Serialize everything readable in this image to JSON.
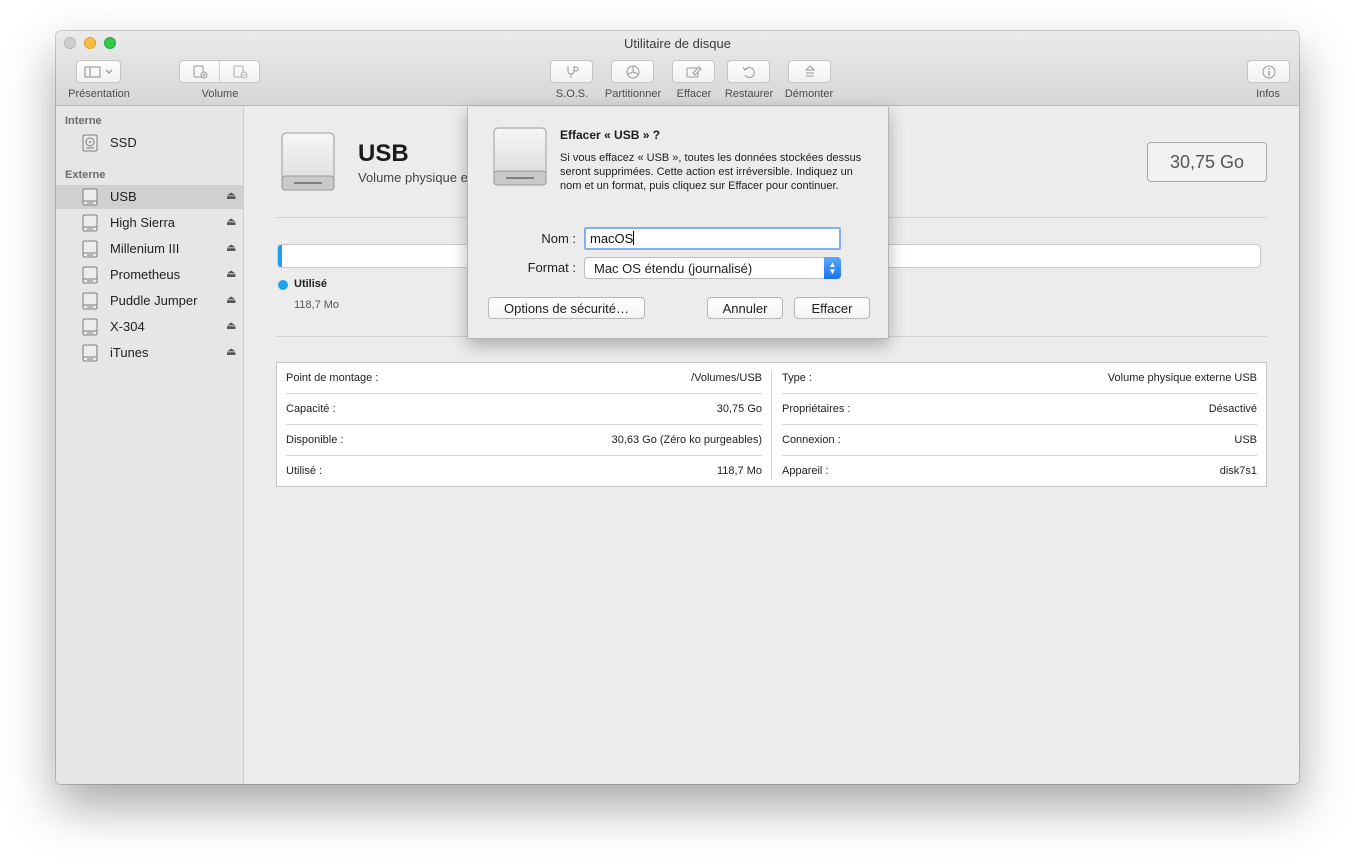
{
  "window": {
    "title": "Utilitaire de disque"
  },
  "toolbar": {
    "presentation_label": "Présentation",
    "volume_label": "Volume",
    "sos_label": "S.O.S.",
    "partition_label": "Partitionner",
    "erase_label": "Effacer",
    "restore_label": "Restaurer",
    "unmount_label": "Démonter",
    "info_label": "Infos"
  },
  "sidebar": {
    "internal_header": "Interne",
    "internal_items": [
      {
        "label": "SSD"
      }
    ],
    "external_header": "Externe",
    "external_items": [
      {
        "label": "USB",
        "eject": "⏏"
      },
      {
        "label": "High Sierra",
        "eject": "⏏"
      },
      {
        "label": "Millenium III",
        "eject": "⏏"
      },
      {
        "label": "Prometheus",
        "eject": "⏏"
      },
      {
        "label": "Puddle Jumper",
        "eject": "⏏"
      },
      {
        "label": "X-304",
        "eject": "⏏"
      },
      {
        "label": "iTunes",
        "eject": "⏏"
      }
    ]
  },
  "main": {
    "disk_name": "USB",
    "disk_subtitle": "Volume physique externe USB",
    "capacity": "30,75 Go",
    "usage": {
      "used_fraction": 0.004,
      "legend_name": "Utilisé",
      "legend_value": "118,7 Mo",
      "color": "#1ca2ea"
    },
    "info_left": [
      {
        "key": "Point de montage :",
        "value": "/Volumes/USB"
      },
      {
        "key": "Capacité :",
        "value": "30,75 Go"
      },
      {
        "key": "Disponible :",
        "value": "30,63 Go (Zéro ko purgeables)"
      },
      {
        "key": "Utilisé :",
        "value": "118,7 Mo"
      }
    ],
    "info_right": [
      {
        "key": "Type :",
        "value": "Volume physique externe USB"
      },
      {
        "key": "Propriétaires :",
        "value": "Désactivé"
      },
      {
        "key": "Connexion :",
        "value": "USB"
      },
      {
        "key": "Appareil :",
        "value": "disk7s1"
      }
    ]
  },
  "dialog": {
    "title": "Effacer « USB » ?",
    "message": "Si vous effacez « USB », toutes les données stockées dessus seront supprimées. Cette action est irréversible. Indiquez un nom et un format, puis cliquez sur Effacer pour continuer.",
    "name_label": "Nom :",
    "name_value": "macOS",
    "format_label": "Format :",
    "format_value": "Mac OS étendu (journalisé)",
    "security_button": "Options de sécurité…",
    "cancel_button": "Annuler",
    "erase_button": "Effacer"
  }
}
